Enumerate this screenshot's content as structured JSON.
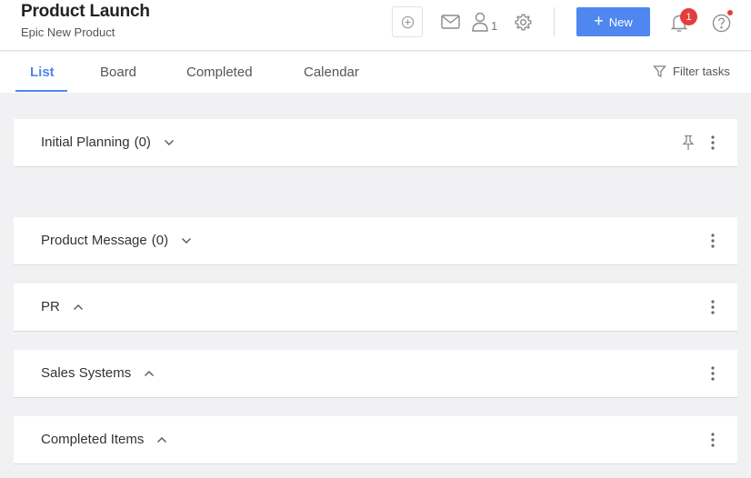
{
  "project": {
    "title": "Product Launch",
    "subtitle": "Epic New Product"
  },
  "toolbar": {
    "add_icon": "circle-plus-icon",
    "mail_icon": "envelope-icon",
    "members_icon": "user-icon",
    "members_count": "1",
    "settings_icon": "gear-icon",
    "new_label": "New",
    "notifications_count": "1",
    "help_icon": "question-icon"
  },
  "tabs": [
    {
      "label": "List",
      "active": true
    },
    {
      "label": "Board",
      "active": false
    },
    {
      "label": "Completed",
      "active": false
    },
    {
      "label": "Calendar",
      "active": false
    }
  ],
  "filter": {
    "label": "Filter tasks"
  },
  "groups": [
    {
      "name": "Initial Planning",
      "count": "(0)",
      "expanded": false,
      "pinned": true
    },
    {
      "name": "Product Message",
      "count": "(0)",
      "expanded": false,
      "pinned": false
    },
    {
      "name": "PR",
      "count": "",
      "expanded": true,
      "pinned": false
    },
    {
      "name": "Sales Systems",
      "count": "",
      "expanded": true,
      "pinned": false
    },
    {
      "name": "Completed Items",
      "count": "",
      "expanded": true,
      "pinned": false
    }
  ],
  "colors": {
    "accent": "#4f86f0",
    "badge": "#e43d3d",
    "background": "#f1f1f3"
  }
}
